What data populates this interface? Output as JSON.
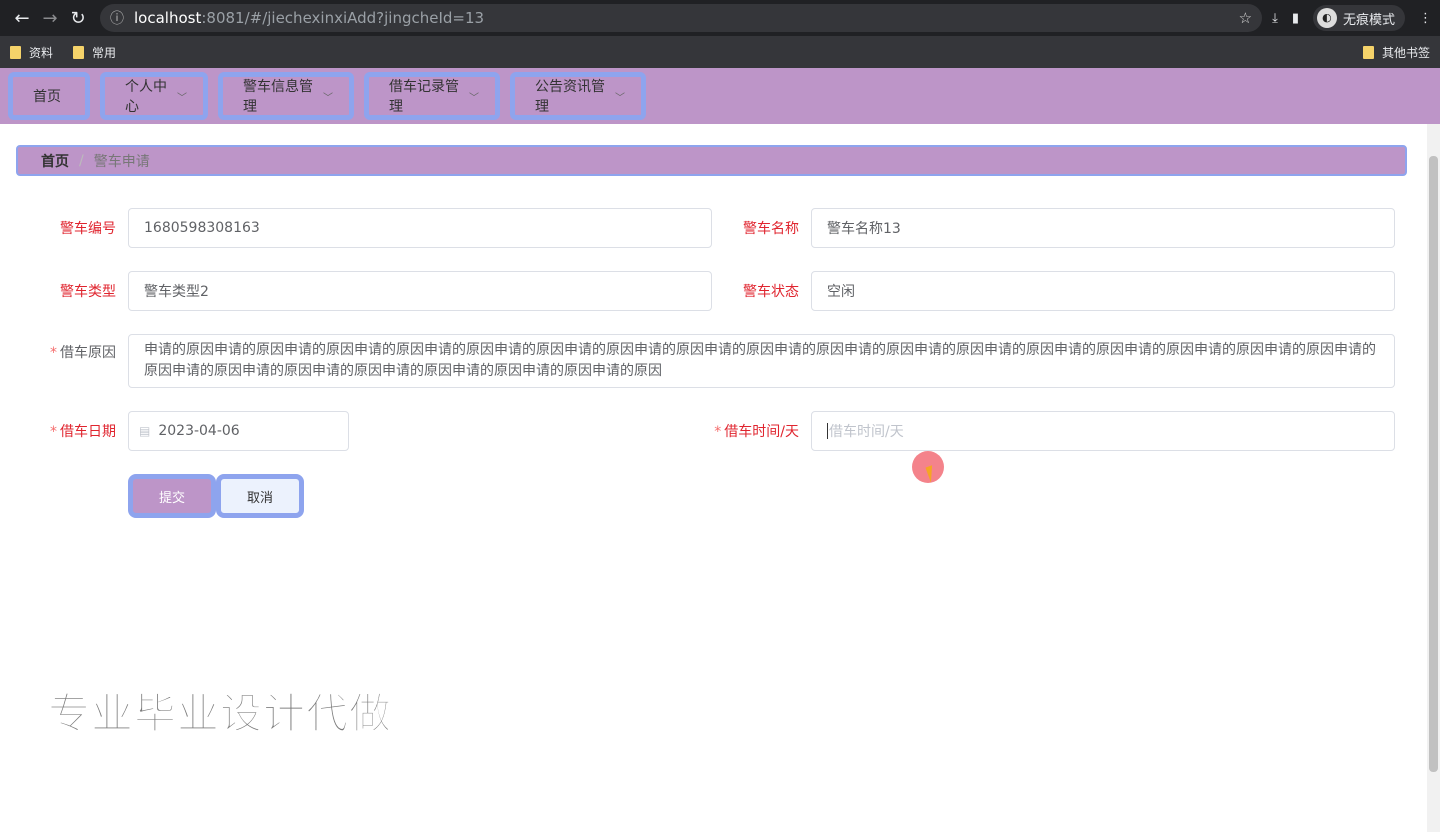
{
  "browser": {
    "url_host": "localhost",
    "url_path": ":8081/#/jiechexinxiAdd?jingcheId=13",
    "profile": "无痕模式",
    "bookmarks": [
      "资料",
      "常用"
    ],
    "other_bookmarks": "其他书签"
  },
  "nav": {
    "items": [
      {
        "label": "首页",
        "dropdown": false
      },
      {
        "label": "个人中心",
        "dropdown": true
      },
      {
        "label": "警车信息管理",
        "dropdown": true
      },
      {
        "label": "借车记录管理",
        "dropdown": true
      },
      {
        "label": "公告资讯管理",
        "dropdown": true
      }
    ]
  },
  "breadcrumb": {
    "home": "首页",
    "separator": "/",
    "current": "警车申请"
  },
  "form": {
    "jingche_bianhao": {
      "label": "警车编号",
      "value": "1680598308163"
    },
    "jingche_name": {
      "label": "警车名称",
      "value": "警车名称13"
    },
    "jingche_type": {
      "label": "警车类型",
      "value": "警车类型2"
    },
    "jingche_status": {
      "label": "警车状态",
      "value": "空闲"
    },
    "reason": {
      "label": "借车原因",
      "required": "*",
      "value": "申请的原因申请的原因申请的原因申请的原因申请的原因申请的原因申请的原因申请的原因申请的原因申请的原因申请的原因申请的原因申请的原因申请的原因申请的原因申请的原因申请的原因申请的原因申请的原因申请的原因申请的原因申请的原因申请的原因申请的原因申请的原因"
    },
    "date": {
      "label": "借车日期",
      "required": "*",
      "value": "2023-04-06"
    },
    "days": {
      "label": "借车时间/天",
      "required": "*",
      "placeholder": "借车时间/天",
      "value": ""
    }
  },
  "buttons": {
    "submit": "提交",
    "cancel": "取消"
  },
  "watermark": "专业毕业设计代做",
  "colors": {
    "nav_bg": "#bd95c8",
    "border_accent": "#8ea4ee",
    "label_red": "#e0252f"
  }
}
